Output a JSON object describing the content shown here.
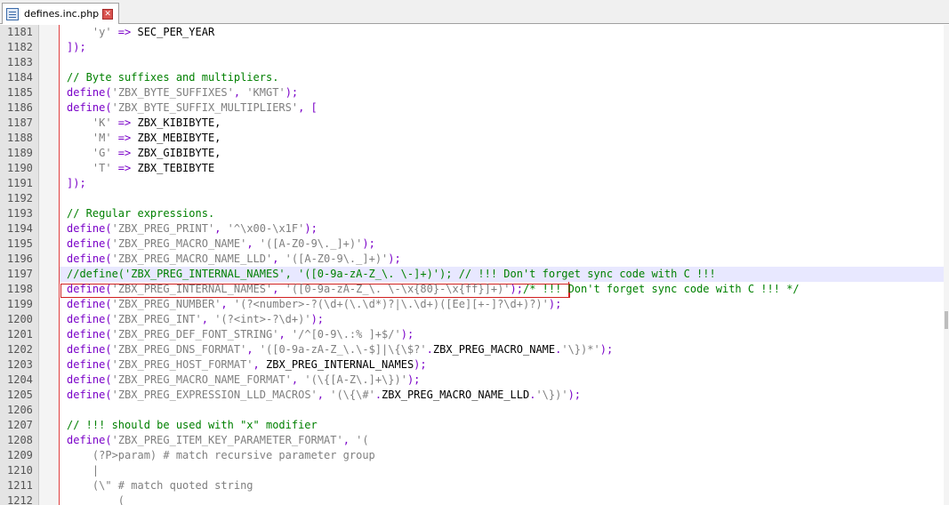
{
  "tab": {
    "title": "defines.inc.php",
    "close_glyph": "✕",
    "icon": "php-file-icon"
  },
  "editor": {
    "lines": [
      {
        "n": "1181",
        "tokens": [
          [
            "s-str",
            "    'y' "
          ],
          [
            "s-op",
            "=>"
          ],
          [
            "s-id",
            " SEC_PER_YEAR"
          ]
        ]
      },
      {
        "n": "1182",
        "tokens": [
          [
            "s-op",
            "]);"
          ]
        ]
      },
      {
        "n": "1183",
        "tokens": []
      },
      {
        "n": "1184",
        "tokens": [
          [
            "s-cmt",
            "// Byte suffixes and multipliers."
          ]
        ]
      },
      {
        "n": "1185",
        "tokens": [
          [
            "s-kw",
            "define"
          ],
          [
            "s-op",
            "("
          ],
          [
            "s-str",
            "'ZBX_BYTE_SUFFIXES'"
          ],
          [
            "s-op",
            ", "
          ],
          [
            "s-str",
            "'KMGT'"
          ],
          [
            "s-op",
            ");"
          ]
        ]
      },
      {
        "n": "1186",
        "tokens": [
          [
            "s-kw",
            "define"
          ],
          [
            "s-op",
            "("
          ],
          [
            "s-str",
            "'ZBX_BYTE_SUFFIX_MULTIPLIERS'"
          ],
          [
            "s-op",
            ", ["
          ]
        ]
      },
      {
        "n": "1187",
        "tokens": [
          [
            "s-str",
            "    'K' "
          ],
          [
            "s-op",
            "=>"
          ],
          [
            "s-id",
            " ZBX_KIBIBYTE,"
          ]
        ]
      },
      {
        "n": "1188",
        "tokens": [
          [
            "s-str",
            "    'M' "
          ],
          [
            "s-op",
            "=>"
          ],
          [
            "s-id",
            " ZBX_MEBIBYTE,"
          ]
        ]
      },
      {
        "n": "1189",
        "tokens": [
          [
            "s-str",
            "    'G' "
          ],
          [
            "s-op",
            "=>"
          ],
          [
            "s-id",
            " ZBX_GIBIBYTE,"
          ]
        ]
      },
      {
        "n": "1190",
        "tokens": [
          [
            "s-str",
            "    'T' "
          ],
          [
            "s-op",
            "=>"
          ],
          [
            "s-id",
            " ZBX_TEBIBYTE"
          ]
        ]
      },
      {
        "n": "1191",
        "tokens": [
          [
            "s-op",
            "]);"
          ]
        ]
      },
      {
        "n": "1192",
        "tokens": []
      },
      {
        "n": "1193",
        "tokens": [
          [
            "s-cmt",
            "// Regular expressions."
          ]
        ]
      },
      {
        "n": "1194",
        "tokens": [
          [
            "s-kw",
            "define"
          ],
          [
            "s-op",
            "("
          ],
          [
            "s-str",
            "'ZBX_PREG_PRINT'"
          ],
          [
            "s-op",
            ", "
          ],
          [
            "s-str",
            "'^\\x00-\\x1F'"
          ],
          [
            "s-op",
            ");"
          ]
        ]
      },
      {
        "n": "1195",
        "tokens": [
          [
            "s-kw",
            "define"
          ],
          [
            "s-op",
            "("
          ],
          [
            "s-str",
            "'ZBX_PREG_MACRO_NAME'"
          ],
          [
            "s-op",
            ", "
          ],
          [
            "s-str",
            "'([A-Z0-9\\._]+)'"
          ],
          [
            "s-op",
            ");"
          ]
        ]
      },
      {
        "n": "1196",
        "tokens": [
          [
            "s-kw",
            "define"
          ],
          [
            "s-op",
            "("
          ],
          [
            "s-str",
            "'ZBX_PREG_MACRO_NAME_LLD'"
          ],
          [
            "s-op",
            ", "
          ],
          [
            "s-str",
            "'([A-Z0-9\\._]+)'"
          ],
          [
            "s-op",
            ");"
          ]
        ]
      },
      {
        "n": "1197",
        "current": true,
        "tokens": [
          [
            "s-cmt",
            "//define('ZBX_PREG_INTERNAL_NAMES', '([0-9a-zA-Z_\\. \\-]+)'); // !!! Don't forget sync code with C !!!"
          ]
        ]
      },
      {
        "n": "1198",
        "tokens": [
          [
            "s-kw",
            "define"
          ],
          [
            "s-op",
            "("
          ],
          [
            "s-str",
            "'ZBX_PREG_INTERNAL_NAMES'"
          ],
          [
            "s-op",
            ", "
          ],
          [
            "s-str",
            "'([0-9a-zA-Z_\\. \\-\\x{80}-\\x{ff}]+)'"
          ],
          [
            "s-op",
            ");"
          ],
          [
            "s-cmt",
            "/* !!! Don't forget sync code with C !!! */"
          ]
        ]
      },
      {
        "n": "1199",
        "tokens": [
          [
            "s-kw",
            "define"
          ],
          [
            "s-op",
            "("
          ],
          [
            "s-str",
            "'ZBX_PREG_NUMBER'"
          ],
          [
            "s-op",
            ", "
          ],
          [
            "s-str",
            "'(?<number>-?(\\d+(\\.\\d*)?|\\.\\d+)([Ee][+-]?\\d+)?)'"
          ],
          [
            "s-op",
            ");"
          ]
        ]
      },
      {
        "n": "1200",
        "tokens": [
          [
            "s-kw",
            "define"
          ],
          [
            "s-op",
            "("
          ],
          [
            "s-str",
            "'ZBX_PREG_INT'"
          ],
          [
            "s-op",
            ", "
          ],
          [
            "s-str",
            "'(?<int>-?\\d+)'"
          ],
          [
            "s-op",
            ");"
          ]
        ]
      },
      {
        "n": "1201",
        "tokens": [
          [
            "s-kw",
            "define"
          ],
          [
            "s-op",
            "("
          ],
          [
            "s-str",
            "'ZBX_PREG_DEF_FONT_STRING'"
          ],
          [
            "s-op",
            ", "
          ],
          [
            "s-str",
            "'/^[0-9\\.:% ]+$/'"
          ],
          [
            "s-op",
            ");"
          ]
        ]
      },
      {
        "n": "1202",
        "tokens": [
          [
            "s-kw",
            "define"
          ],
          [
            "s-op",
            "("
          ],
          [
            "s-str",
            "'ZBX_PREG_DNS_FORMAT'"
          ],
          [
            "s-op",
            ", "
          ],
          [
            "s-str",
            "'([0-9a-zA-Z_\\.\\-$]|\\{\\$?'"
          ],
          [
            "s-op",
            "."
          ],
          [
            "s-id",
            "ZBX_PREG_MACRO_NAME"
          ],
          [
            "s-op",
            "."
          ],
          [
            "s-str",
            "'\\})*'"
          ],
          [
            "s-op",
            ");"
          ]
        ]
      },
      {
        "n": "1203",
        "tokens": [
          [
            "s-kw",
            "define"
          ],
          [
            "s-op",
            "("
          ],
          [
            "s-str",
            "'ZBX_PREG_HOST_FORMAT'"
          ],
          [
            "s-op",
            ", "
          ],
          [
            "s-id",
            "ZBX_PREG_INTERNAL_NAMES"
          ],
          [
            "s-op",
            ");"
          ]
        ]
      },
      {
        "n": "1204",
        "tokens": [
          [
            "s-kw",
            "define"
          ],
          [
            "s-op",
            "("
          ],
          [
            "s-str",
            "'ZBX_PREG_MACRO_NAME_FORMAT'"
          ],
          [
            "s-op",
            ", "
          ],
          [
            "s-str",
            "'(\\{[A-Z\\.]+\\})'"
          ],
          [
            "s-op",
            ");"
          ]
        ]
      },
      {
        "n": "1205",
        "tokens": [
          [
            "s-kw",
            "define"
          ],
          [
            "s-op",
            "("
          ],
          [
            "s-str",
            "'ZBX_PREG_EXPRESSION_LLD_MACROS'"
          ],
          [
            "s-op",
            ", "
          ],
          [
            "s-str",
            "'(\\{\\#'"
          ],
          [
            "s-op",
            "."
          ],
          [
            "s-id",
            "ZBX_PREG_MACRO_NAME_LLD"
          ],
          [
            "s-op",
            "."
          ],
          [
            "s-str",
            "'\\})'"
          ],
          [
            "s-op",
            ");"
          ]
        ]
      },
      {
        "n": "1206",
        "tokens": []
      },
      {
        "n": "1207",
        "tokens": [
          [
            "s-cmt",
            "// !!! should be used with \"x\" modifier"
          ]
        ]
      },
      {
        "n": "1208",
        "tokens": [
          [
            "s-kw",
            "define"
          ],
          [
            "s-op",
            "("
          ],
          [
            "s-str",
            "'ZBX_PREG_ITEM_KEY_PARAMETER_FORMAT'"
          ],
          [
            "s-op",
            ", "
          ],
          [
            "s-str",
            "'("
          ]
        ]
      },
      {
        "n": "1209",
        "tokens": [
          [
            "s-str",
            "    (?P>param) # match recursive parameter group"
          ]
        ]
      },
      {
        "n": "1210",
        "tokens": [
          [
            "s-str",
            "    |"
          ]
        ]
      },
      {
        "n": "1211",
        "tokens": [
          [
            "s-str",
            "    (\\\" # match quoted string"
          ]
        ]
      },
      {
        "n": "1212",
        "tokens": [
          [
            "s-str",
            "        ("
          ]
        ]
      }
    ]
  }
}
